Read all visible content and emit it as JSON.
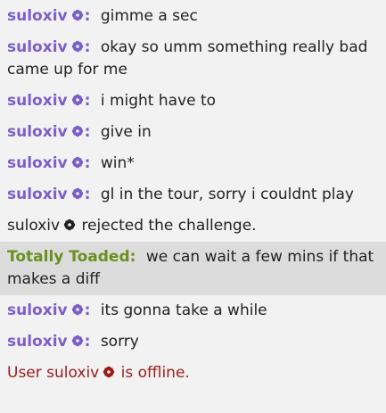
{
  "colors": {
    "suloxiv": "#7b5ec9",
    "totally_toaded": "#6a8f1f",
    "highlight_bg": "#dcdcdc",
    "offline_text": "#9a1b1b",
    "background": "#f2f2f2"
  },
  "icons": {
    "user_badge": "flower-icon"
  },
  "messages": [
    {
      "user": "suloxiv",
      "text": "gimme a sec"
    },
    {
      "user": "suloxiv",
      "text": "okay so umm something really bad came up for me"
    },
    {
      "user": "suloxiv",
      "text": "i might have to"
    },
    {
      "user": "suloxiv",
      "text": "give in"
    },
    {
      "user": "suloxiv",
      "text": "win*"
    },
    {
      "user": "suloxiv",
      "text": "gl in the tour, sorry i couldnt play"
    },
    {
      "user": "suloxiv",
      "text": "rejected the challenge."
    },
    {
      "user": "Totally Toaded",
      "text": "we can wait a few mins if that makes a diff"
    },
    {
      "user": "suloxiv",
      "text": "its gonna take a while"
    },
    {
      "user": "suloxiv",
      "text": "sorry"
    },
    {
      "prefix": "User",
      "user": "suloxiv",
      "text": "is offline."
    }
  ]
}
